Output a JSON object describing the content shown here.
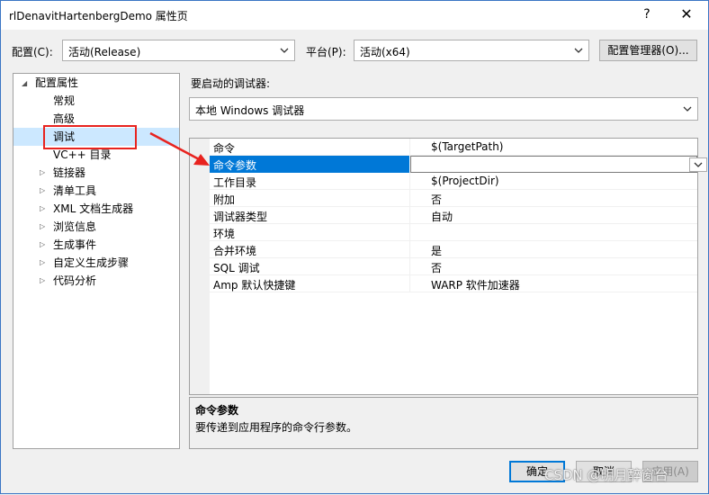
{
  "window": {
    "title": "rlDenavitHartenbergDemo 属性页",
    "help_glyph": "?",
    "close_glyph": "✕"
  },
  "config_row": {
    "config_label": "配置(C):",
    "config_value": "活动(Release)",
    "platform_label": "平台(P):",
    "platform_value": "活动(x64)",
    "manager_button": "配置管理器(O)..."
  },
  "tree": {
    "root": "配置属性",
    "items": [
      {
        "label": "常规",
        "expandable": false
      },
      {
        "label": "高级",
        "expandable": false
      },
      {
        "label": "调试",
        "expandable": false,
        "selected": true
      },
      {
        "label": "VC++ 目录",
        "expandable": false
      },
      {
        "label": "链接器",
        "expandable": true
      },
      {
        "label": "清单工具",
        "expandable": true
      },
      {
        "label": "XML 文档生成器",
        "expandable": true
      },
      {
        "label": "浏览信息",
        "expandable": true
      },
      {
        "label": "生成事件",
        "expandable": true
      },
      {
        "label": "自定义生成步骤",
        "expandable": true
      },
      {
        "label": "代码分析",
        "expandable": true
      }
    ]
  },
  "debugger": {
    "label": "要启动的调试器:",
    "value": "本地 Windows 调试器"
  },
  "properties": [
    {
      "name": "命令",
      "value": "$(TargetPath)"
    },
    {
      "name": "命令参数",
      "value": "",
      "selected": true
    },
    {
      "name": "工作目录",
      "value": "$(ProjectDir)"
    },
    {
      "name": "附加",
      "value": "否"
    },
    {
      "name": "调试器类型",
      "value": "自动"
    },
    {
      "name": "环境",
      "value": ""
    },
    {
      "name": "合并环境",
      "value": "是"
    },
    {
      "name": "SQL 调试",
      "value": "否"
    },
    {
      "name": "Amp 默认快捷键",
      "value": "WARP 软件加速器"
    }
  ],
  "description": {
    "title": "命令参数",
    "text": "要传递到应用程序的命令行参数。"
  },
  "buttons": {
    "ok": "确定",
    "cancel": "取消",
    "apply": "应用(A)"
  },
  "watermark": "CSDN @明月醉窗台",
  "colors": {
    "selection": "#0078d7",
    "tree_selection": "#cce8ff",
    "annotation_red": "#e8231f"
  }
}
